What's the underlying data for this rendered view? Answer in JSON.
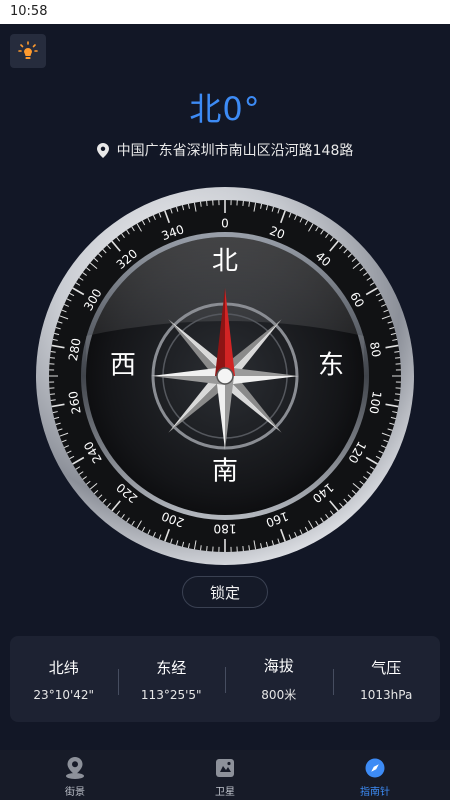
{
  "status_bar": {
    "time": "10:58"
  },
  "icons": {
    "lamp": "lightbulb-icon",
    "location": "location-pin-icon"
  },
  "heading": {
    "text": "北0°"
  },
  "location": {
    "address": "中国广东省深圳市南山区沿河路148路"
  },
  "compass": {
    "heading_degrees": 0,
    "scale_labels": [
      "0",
      "20",
      "40",
      "60",
      "80",
      "100",
      "120",
      "140",
      "160",
      "180",
      "200",
      "220",
      "240",
      "260",
      "280",
      "300",
      "320",
      "340"
    ],
    "directions": {
      "north": "北",
      "east": "东",
      "south": "南",
      "west": "西"
    }
  },
  "lock_button": {
    "label": "锁定"
  },
  "info": [
    {
      "label": "北纬",
      "value": "23°10'42\""
    },
    {
      "label": "东经",
      "value": "113°25'5\""
    },
    {
      "label": "海拔",
      "value": "800米"
    },
    {
      "label": "气压",
      "value": "1013hPa"
    }
  ],
  "nav": {
    "active": 2,
    "tabs": [
      {
        "label": "街景",
        "icon": "map-pin-icon"
      },
      {
        "label": "卫星",
        "icon": "satellite-map-icon"
      },
      {
        "label": "指南针",
        "icon": "compass-icon"
      }
    ]
  },
  "colors": {
    "accent": "#3d8bf5",
    "background": "#121726",
    "needle_north": "#b81d1d"
  }
}
